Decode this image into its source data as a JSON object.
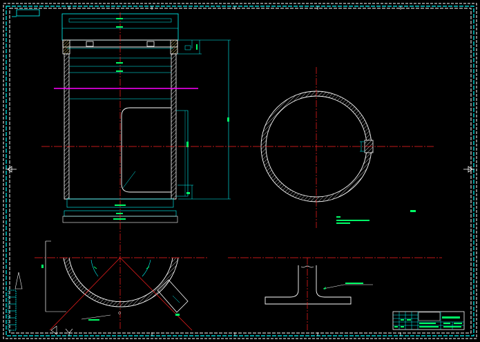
{
  "drawing": {
    "colors": {
      "background": "#000000",
      "cyan": "#00ffff",
      "red": "#ff2020",
      "white": "#ffffff",
      "green": "#00ff66",
      "magenta": "#ff00ff"
    },
    "notes": {
      "tech_req_title": "",
      "tech_req_line": "",
      "sheet_label": "",
      "detail_label": "",
      "bottom_label": ""
    }
  }
}
